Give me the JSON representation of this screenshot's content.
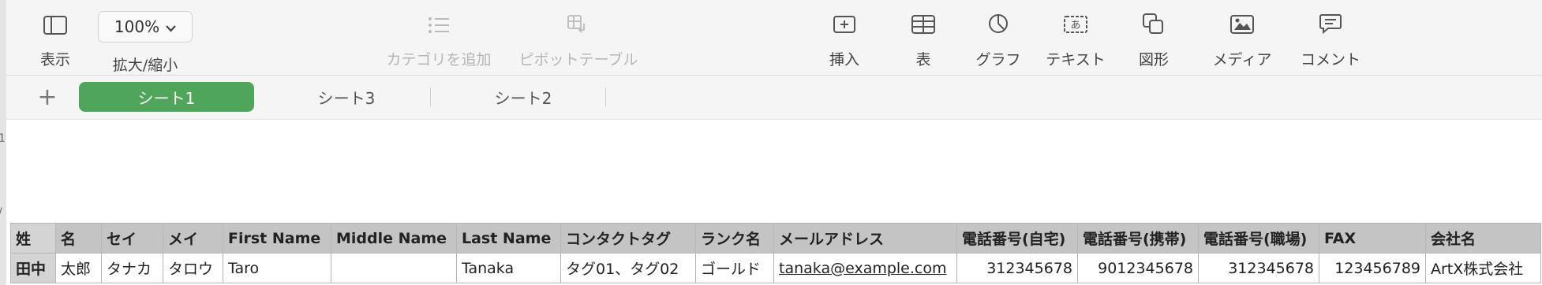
{
  "toolbar": {
    "view": {
      "label": "表示",
      "icon": "sidebar-icon"
    },
    "zoom": {
      "value": "100%",
      "label": "拡大/縮小",
      "icon": "chevron-down-icon"
    },
    "add_category": {
      "label": "カテゴリを追加",
      "icon": "list-icon",
      "enabled": false
    },
    "pivot_table": {
      "label": "ピボットテーブル",
      "icon": "pivot-table-icon",
      "enabled": false
    },
    "insert": {
      "label": "挿入",
      "icon": "insert-icon"
    },
    "table": {
      "label": "表",
      "icon": "table-icon"
    },
    "chart": {
      "label": "グラフ",
      "icon": "chart-icon"
    },
    "text": {
      "label": "テキスト",
      "icon": "text-box-icon"
    },
    "shape": {
      "label": "図形",
      "icon": "shape-icon"
    },
    "media": {
      "label": "メディア",
      "icon": "media-icon"
    },
    "comment": {
      "label": "コメント",
      "icon": "comment-icon"
    }
  },
  "sheets": {
    "add_label": "+",
    "tabs": [
      {
        "label": "シート1",
        "active": true
      },
      {
        "label": "シート3",
        "active": false
      },
      {
        "label": "シート2",
        "active": false
      }
    ]
  },
  "table": {
    "headers": [
      "姓",
      "名",
      "セイ",
      "メイ",
      "First Name",
      "Middle Name",
      "Last Name",
      "コンタクトタグ",
      "ランク名",
      "メールアドレス",
      "電話番号(自宅)",
      "電話番号(携帯)",
      "電話番号(職場)",
      "FAX",
      "会社名"
    ],
    "rows": [
      [
        "田中",
        "太郎",
        "タナカ",
        "タロウ",
        "Taro",
        "",
        "Tanaka",
        "タグ01、タグ02",
        "ゴールド",
        "tanaka@example.com",
        "312345678",
        "9012345678",
        "312345678",
        "123456789",
        "ArtX株式会社"
      ]
    ]
  },
  "colors": {
    "active_tab": "#4fa55a",
    "toolbar_bg": "#f5f5f5",
    "header_bg": "#c4c4c4"
  }
}
